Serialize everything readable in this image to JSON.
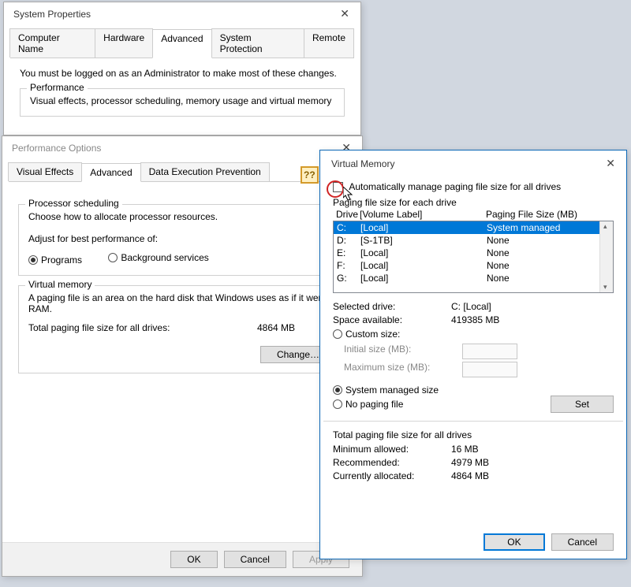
{
  "sysprops": {
    "title": "System Properties",
    "tabs": [
      "Computer Name",
      "Hardware",
      "Advanced",
      "System Protection",
      "Remote"
    ],
    "active_tab": "Advanced",
    "admin_note": "You must be logged on as an Administrator to make most of these changes.",
    "perf_group": "Performance",
    "perf_desc": "Visual effects, processor scheduling, memory usage and virtual memory"
  },
  "perfopt": {
    "title": "Performance Options",
    "tabs": [
      "Visual Effects",
      "Advanced",
      "Data Execution Prevention"
    ],
    "active_tab": "Advanced",
    "ps_group": "Processor scheduling",
    "ps_desc": "Choose how to allocate processor resources.",
    "ps_adjust": "Adjust for best performance of:",
    "ps_programs": "Programs",
    "ps_bg": "Background services",
    "vm_group": "Virtual memory",
    "vm_desc": "A paging file is an area on the hard disk that Windows uses as if it were RAM.",
    "vm_total_label": "Total paging file size for all drives:",
    "vm_total_value": "4864 MB",
    "change_btn": "Change…",
    "ok": "OK",
    "cancel": "Cancel",
    "apply": "Apply"
  },
  "annot": {
    "qq": "??"
  },
  "vmem": {
    "title": "Virtual Memory",
    "auto": "Automatically manage paging file size for all drives",
    "each": "Paging file size for each drive",
    "hdr_drive": "Drive",
    "hdr_vol": "[Volume Label]",
    "hdr_size": "Paging File Size (MB)",
    "drives": [
      {
        "letter": "C:",
        "label": "[Local]",
        "size": "System managed",
        "sel": true
      },
      {
        "letter": "D:",
        "label": "[S-1TB]",
        "size": "None",
        "sel": false
      },
      {
        "letter": "E:",
        "label": "[Local]",
        "size": "None",
        "sel": false
      },
      {
        "letter": "F:",
        "label": "[Local]",
        "size": "None",
        "sel": false
      },
      {
        "letter": "G:",
        "label": "[Local]",
        "size": "None",
        "sel": false
      }
    ],
    "sel_drive_lbl": "Selected drive:",
    "sel_drive_val": "C:  [Local]",
    "space_lbl": "Space available:",
    "space_val": "419385 MB",
    "custom": "Custom size:",
    "init_lbl": "Initial size (MB):",
    "max_lbl": "Maximum size (MB):",
    "sys_managed": "System managed size",
    "no_pf": "No paging file",
    "set_btn": "Set",
    "totals_hdr": "Total paging file size for all drives",
    "min_lbl": "Minimum allowed:",
    "min_val": "16 MB",
    "rec_lbl": "Recommended:",
    "rec_val": "4979 MB",
    "cur_lbl": "Currently allocated:",
    "cur_val": "4864 MB",
    "ok": "OK",
    "cancel": "Cancel"
  }
}
